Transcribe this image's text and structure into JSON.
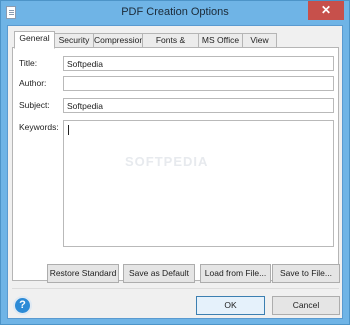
{
  "window": {
    "title": "PDF Creation Options",
    "close_symbol": "✕"
  },
  "tabs": [
    {
      "label": "General",
      "active": true
    },
    {
      "label": "Security",
      "active": false
    },
    {
      "label": "Compression",
      "active": false
    },
    {
      "label": "Fonts & Colors",
      "active": false
    },
    {
      "label": "MS Office",
      "active": false
    },
    {
      "label": "View",
      "active": false
    }
  ],
  "form": {
    "title_label": "Title:",
    "title_value": "Softpedia",
    "author_label": "Author:",
    "author_value": "",
    "subject_label": "Subject:",
    "subject_value": "Softpedia",
    "keywords_label": "Keywords:",
    "keywords_value": ""
  },
  "actions": {
    "restore_standard": "Restore Standard",
    "save_as_default": "Save as Default",
    "load_from_file": "Load from File...",
    "save_to_file": "Save to File..."
  },
  "footer": {
    "help_symbol": "?",
    "ok": "OK",
    "cancel": "Cancel"
  },
  "watermark": "SOFTPEDIA",
  "colors": {
    "accent_frame": "#6fb4e6",
    "close_button": "#c7504b",
    "help_icon": "#2d8bd6"
  }
}
